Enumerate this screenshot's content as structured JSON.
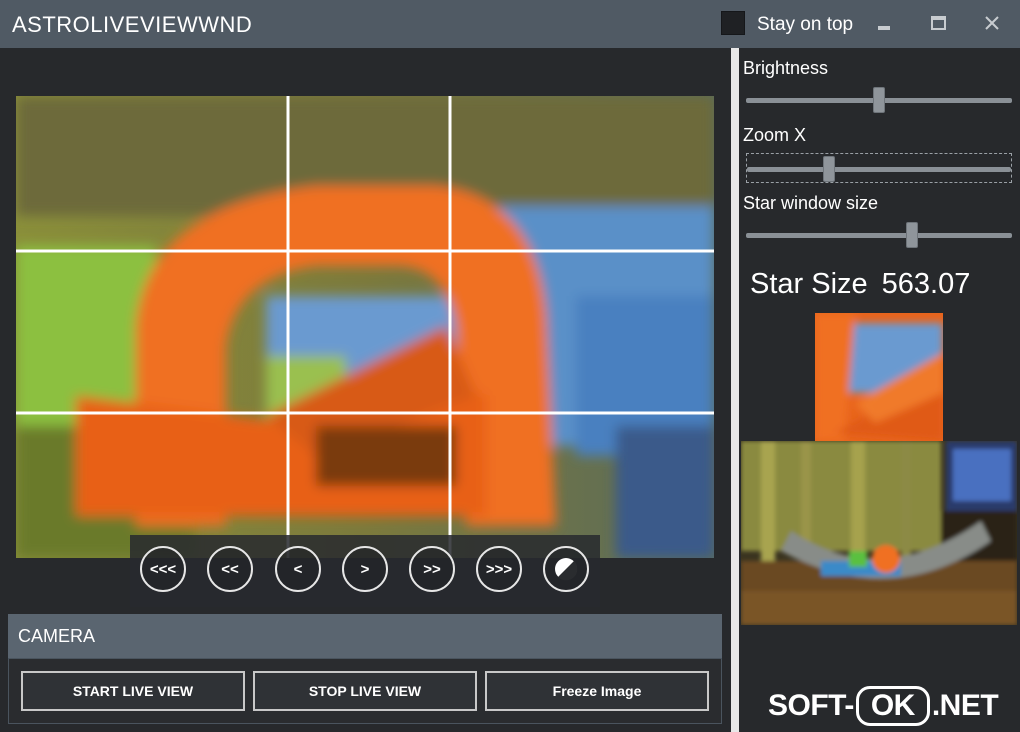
{
  "window": {
    "title": "ASTROLIVEVIEWWND",
    "stay_on_top_label": "Stay on top",
    "stay_on_top_checked": false
  },
  "controls": {
    "minimize": "minimize-icon",
    "maximize": "maximize-icon",
    "close": "close-icon"
  },
  "navigation": {
    "buttons": [
      {
        "id": "nav-far-left",
        "label": "<<<"
      },
      {
        "id": "nav-mid-left",
        "label": "<<"
      },
      {
        "id": "nav-left",
        "label": "<"
      },
      {
        "id": "nav-right",
        "label": ">"
      },
      {
        "id": "nav-mid-right",
        "label": ">>"
      },
      {
        "id": "nav-far-right",
        "label": ">>>"
      }
    ],
    "contrast_icon": "contrast-icon"
  },
  "camera": {
    "section_title": "CAMERA",
    "start_label": "START LIVE VIEW",
    "stop_label": "STOP LIVE VIEW",
    "freeze_label": "Freeze Image"
  },
  "settings": {
    "brightness": {
      "label": "Brightness",
      "value": 0.5
    },
    "zoom_x": {
      "label": "Zoom X",
      "value": 0.3
    },
    "star_window_size": {
      "label": "Star window size",
      "value": 0.63
    }
  },
  "star_size": {
    "label": "Star Size",
    "value": "563.07"
  },
  "watermark": {
    "prefix": "SOFT-",
    "middle": "OK",
    "suffix": ".NET"
  },
  "colors": {
    "titlebar": "#505a64",
    "panel": "#27292c",
    "accent_orange": "#f07020"
  }
}
